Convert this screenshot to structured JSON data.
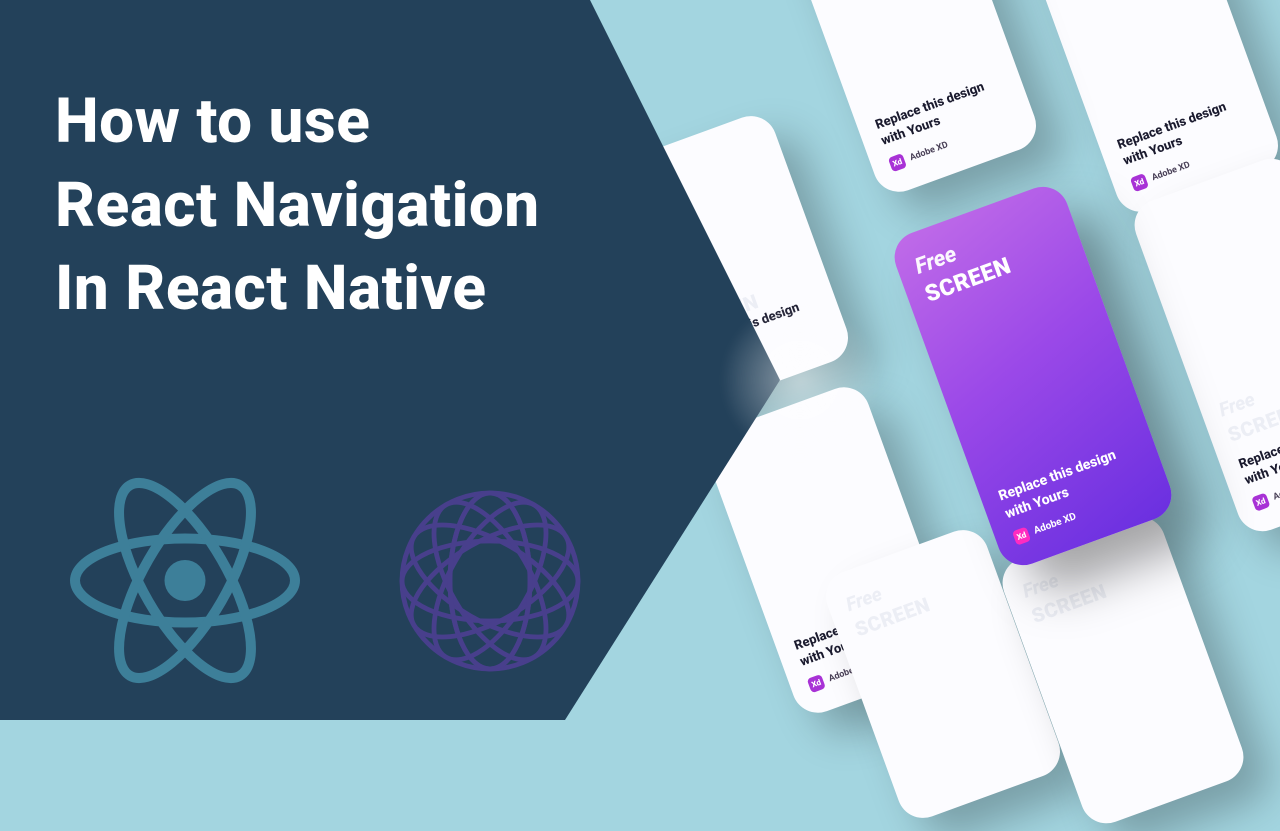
{
  "title": {
    "line1": "How to use",
    "line2": "React Navigation",
    "line3": "In React Native"
  },
  "icons": {
    "react": "react-logo",
    "nav": "react-navigation-logo"
  },
  "colors": {
    "panel": "#23415a",
    "bg": "#a3d5e0",
    "react": "#3d7f99",
    "nav": "#4a3f8f",
    "featured_start": "#c06be8",
    "featured_end": "#6a2fe0",
    "xd": "#a832d6"
  },
  "card": {
    "line1": "Free",
    "line2": "SCREEN",
    "replace_line1": "Replace this design",
    "replace_line2": "with Yours",
    "tool": "Adobe XD",
    "xd_abbrev": "Xd"
  }
}
